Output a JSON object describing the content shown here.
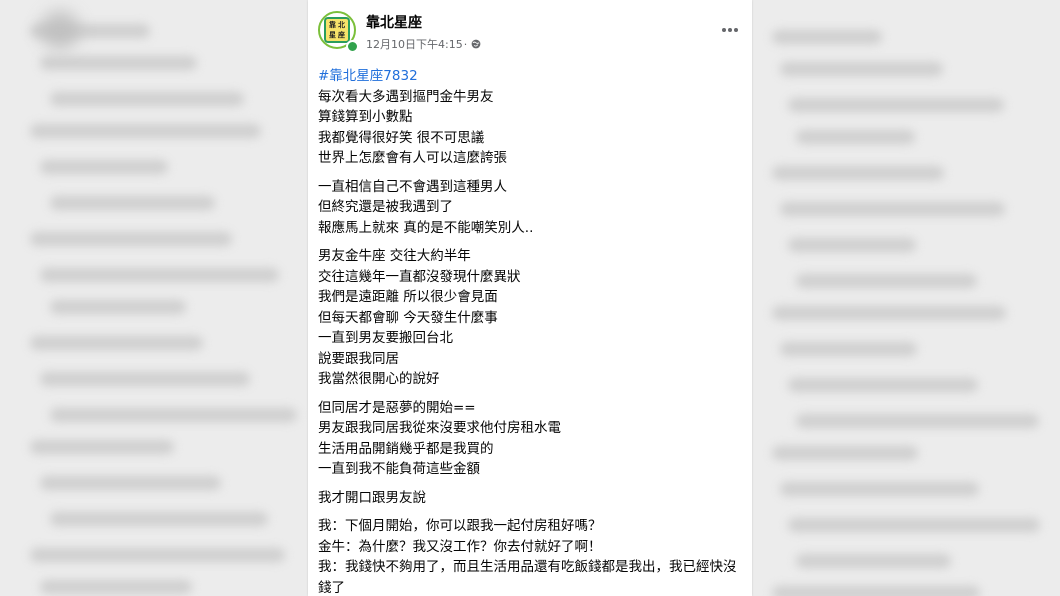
{
  "post": {
    "page_name": "靠北星座",
    "timestamp": "12月10日下午4:15",
    "privacy_icon": "globe-icon",
    "more_icon": "more-horizontal-icon",
    "avatar_text": [
      "靠",
      "北",
      "星",
      "座"
    ],
    "hashtag": "#靠北星座7832",
    "paragraphs": [
      [
        "每次看大多遇到摳門金牛男友",
        "算錢算到小數點",
        "我都覺得很好笑 很不可思議",
        "世界上怎麼會有人可以這麼誇張"
      ],
      [
        "一直相信自己不會遇到這種男人",
        "但終究還是被我遇到了",
        "報應馬上就來 真的是不能嘲笑別人.."
      ],
      [
        "男友金牛座 交往大約半年",
        "交往這幾年一直都沒發現什麼異狀",
        "我們是遠距離 所以很少會見面",
        "但每天都會聊 今天發生什麼事",
        "一直到男友要搬回台北",
        "說要跟我同居",
        "我當然很開心的說好"
      ],
      [
        "但同居才是惡夢的開始==",
        "男友跟我同居我從來沒要求他付房租水電",
        "生活用品開銷幾乎都是我買的",
        "一直到我不能負荷這些金額"
      ],
      [
        "我才開口跟男友說"
      ],
      [
        "我：下個月開始，你可以跟我一起付房租好嗎？",
        "金牛：為什麼？我又沒工作？你去付就好了啊！",
        "我：我錢快不夠用了，而且生活用品還有吃飯錢都是我出，我已經快沒錢了"
      ]
    ]
  },
  "colors": {
    "link": "#216fdb",
    "text": "#050505",
    "meta": "#65676b",
    "online": "#31a24c",
    "avatar_border": "#7bbf3a"
  }
}
